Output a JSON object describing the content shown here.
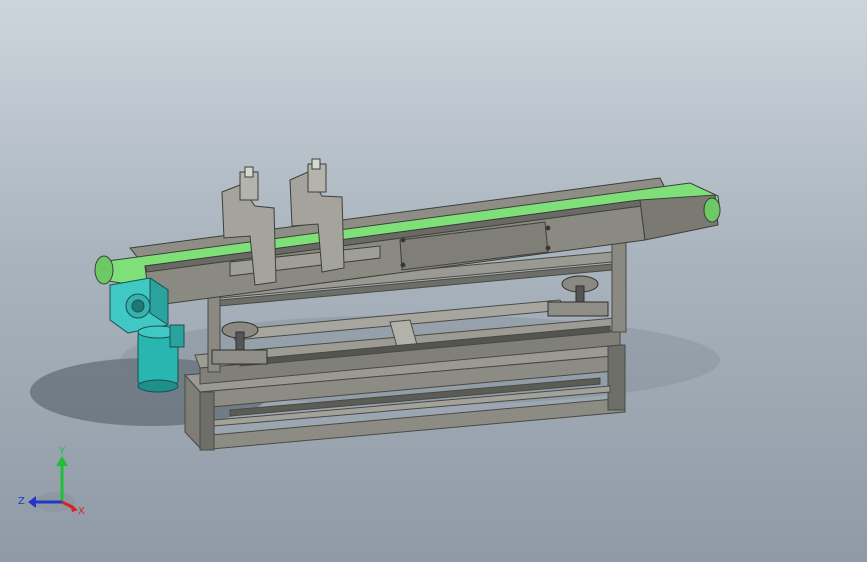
{
  "viewport": {
    "background_top": "#cdd5dc",
    "background_bottom": "#8f9aa6"
  },
  "model": {
    "belt_color": "#7fe07a",
    "frame_color": "#8f8f86",
    "frame_dark": "#5d5d57",
    "motor_color": "#2ab6b0",
    "gearbox_color": "#3fc8c4"
  },
  "triad": {
    "y_label": "Y",
    "z_label": "Z",
    "x_label": "X",
    "y_color": "#1fbf3a",
    "z_color": "#2436c8",
    "x_color": "#d8222a"
  }
}
